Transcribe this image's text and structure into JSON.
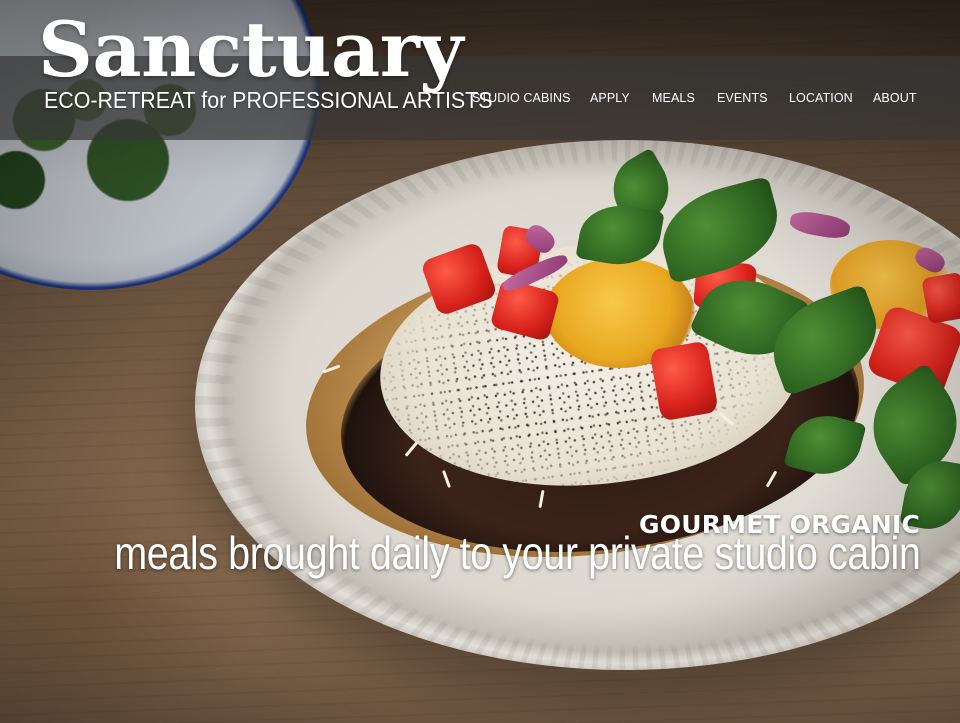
{
  "site": {
    "title": "Sanctuary",
    "tagline": "ECO-RETREAT for PROFESSIONAL ARTISTS"
  },
  "nav": {
    "items": [
      {
        "label": "STUDIO CABINS"
      },
      {
        "label": "APPLY"
      },
      {
        "label": "MEALS"
      },
      {
        "label": "EVENTS"
      },
      {
        "label": "LOCATION"
      },
      {
        "label": "ABOUT"
      }
    ]
  },
  "hero": {
    "headline": "GOURMET ORGANIC",
    "subline": "meals brought daily to your private studio cabin"
  },
  "colors": {
    "header_bar": "rgba(55,55,55,0.72)",
    "text": "#ffffff"
  }
}
